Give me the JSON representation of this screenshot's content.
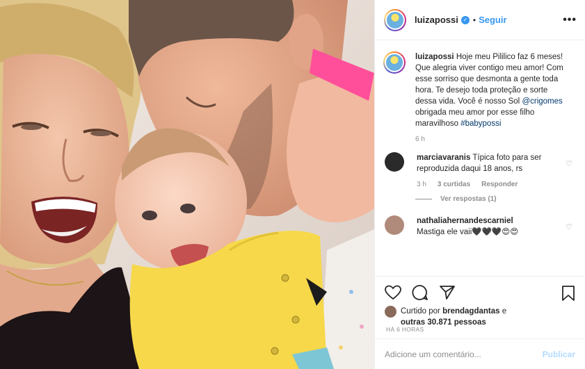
{
  "header": {
    "username": "luizapossi",
    "verified_mark": "✓",
    "separator": "•",
    "follow_label": "Seguir",
    "more_label": "•••"
  },
  "caption": {
    "username": "luizapossi",
    "text_1": "Hoje meu Pililico faz 6 meses! Que alegria viver contigo meu amor! Com esse sorriso que desmonta a gente toda hora. Te desejo toda proteção e sorte dessa vida. Você é nosso Sol ",
    "mention": "@crigomes",
    "text_2": " obrigada meu amor por esse filho maravilhoso ",
    "hashtag": "#babypossi",
    "time": "6 h"
  },
  "comments": [
    {
      "username": "marciavaranis",
      "text": "Típica foto para ser reproduzida daqui 18 anos, rs",
      "time": "3 h",
      "likes": "3 curtidas",
      "reply_label": "Responder",
      "view_replies": "Ver respostas (1)"
    },
    {
      "username": "nathaliahernandescarniel",
      "text": "Mastiga ele vaii🖤🖤🖤😍😍"
    }
  ],
  "likes": {
    "line_1_prefix": "Curtido por ",
    "liker": "brendagdantas",
    "line_1_suffix": " e",
    "line_2": "outras 30.871 pessoas"
  },
  "timestamp": "HÁ 6 HORAS",
  "add_comment": {
    "placeholder": "Adicione um comentário...",
    "publish_label": "Publicar"
  },
  "icons": {
    "like": "heart-icon",
    "comment": "comment-icon",
    "share": "share-icon",
    "save": "bookmark-icon"
  },
  "colors": {
    "accent": "#3897f0",
    "publish_disabled": "#b3dbff",
    "muted": "#8e8e8e",
    "wristband": "#ff4f9a",
    "baby_shirt": "#f6d84a"
  }
}
